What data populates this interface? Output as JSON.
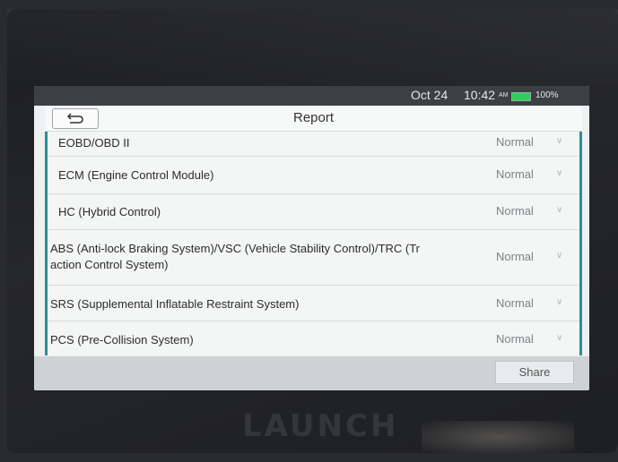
{
  "status_bar": {
    "date": "Oct 24",
    "time": "10:42",
    "ampm": "AM",
    "battery": "100%",
    "battery_color": "#2fcf55"
  },
  "header": {
    "title": "Report",
    "back_icon": "back-arrow-icon"
  },
  "report_items": [
    {
      "label": "EOBD/OBD II",
      "status": "Normal"
    },
    {
      "label": "ECM (Engine Control Module)",
      "status": "Normal"
    },
    {
      "label": "HC (Hybrid Control)",
      "status": "Normal"
    },
    {
      "label": "ABS (Anti-lock Braking System)/VSC (Vehicle Stability Control)/TRC (Tr",
      "label_line2": "action Control System)",
      "status": "Normal"
    },
    {
      "label": "SRS (Supplemental Inflatable Restraint System)",
      "status": "Normal"
    },
    {
      "label": "PCS (Pre-Collision System)",
      "status": "Normal"
    }
  ],
  "footer": {
    "share_label": "Share"
  },
  "device": {
    "brand": "LAUNCH"
  },
  "colors": {
    "accent": "#2d8f96",
    "status_bar": "#3c3f44"
  }
}
